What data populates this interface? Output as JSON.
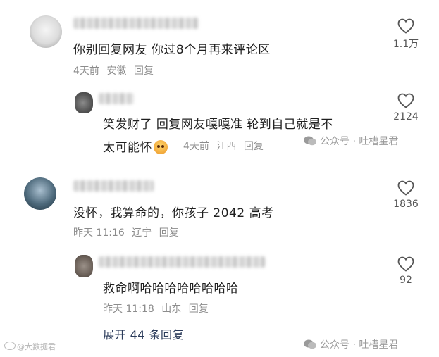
{
  "comments": [
    {
      "text_line1": "你别回复网友 你过8个月再来评论区",
      "meta": {
        "time": "4天前",
        "location": "安徽",
        "reply": "回复"
      },
      "likes": "1.1万",
      "avatar_icon": "user-avatar-icon"
    },
    {
      "text_line1": "笑发财了  回复网友嘎嘎准  轮到自己就是不",
      "text_line2": "太可能怀",
      "emoji_icon": "shy-face-emoji-icon",
      "meta": {
        "time": "4天前",
        "location": "江西",
        "reply": "回复"
      },
      "likes": "2124",
      "avatar_icon": "user-avatar-icon"
    },
    {
      "text_line1": "没怀，我算命的，你孩子 2042 高考",
      "meta": {
        "time": "昨天 11:16",
        "location": "辽宁",
        "reply": "回复"
      },
      "likes": "1836",
      "avatar_icon": "user-avatar-icon"
    },
    {
      "text_line1": "救命啊哈哈哈哈哈哈哈哈",
      "meta": {
        "time": "昨天 11:18",
        "location": "山东",
        "reply": "回复"
      },
      "likes": "92",
      "avatar_icon": "user-avatar-icon"
    }
  ],
  "expand_replies": "展开 44 条回复",
  "watermarks": {
    "wechat_1": "公众号 · 吐槽星君",
    "wechat_2": "公众号 · 吐槽星君",
    "weibo": "@大数据君"
  },
  "colors": {
    "text": "#1f1f1f",
    "meta": "#8c8c8c",
    "link": "#2b3b5a"
  }
}
